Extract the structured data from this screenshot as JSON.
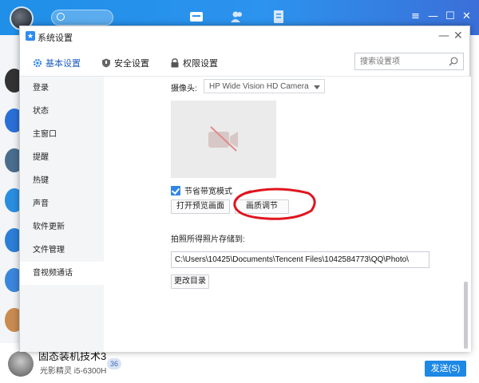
{
  "background_window": {
    "contact_name": "固态装机技术3",
    "contact_sub": "光影精灵 i5-6300H",
    "badge": "36",
    "send_button": "发送(S)",
    "window_controls": [
      "≡",
      "—",
      "☐",
      "✕"
    ]
  },
  "dialog": {
    "title": "系统设置",
    "controls": {
      "minimize": "—",
      "close": "✕"
    },
    "tabs": [
      {
        "label": "基本设置",
        "icon": "gear-icon",
        "active": true
      },
      {
        "label": "安全设置",
        "icon": "shield-icon",
        "active": false
      },
      {
        "label": "权限设置",
        "icon": "lock-icon",
        "active": false
      }
    ],
    "search": {
      "placeholder": "搜索设置项"
    },
    "sidebar": [
      {
        "label": "登录"
      },
      {
        "label": "状态"
      },
      {
        "label": "主窗口"
      },
      {
        "label": "提醒"
      },
      {
        "label": "热键"
      },
      {
        "label": "声音"
      },
      {
        "label": "软件更新"
      },
      {
        "label": "文件管理"
      },
      {
        "label": "音视频通话",
        "active": true
      }
    ],
    "content": {
      "camera_label": "摄像头:",
      "camera_value": "HP Wide Vision HD Camera",
      "bandwidth_checkbox": {
        "label": "节省带宽模式",
        "checked": true
      },
      "open_preview_button": "打开预览画面",
      "quality_button": "画质调节",
      "store_label": "拍照所得照片存储到:",
      "store_path": "C:\\Users\\10425\\Documents\\Tencent Files\\1042584773\\QQ\\Photo\\",
      "change_dir_button": "更改目录"
    }
  },
  "colors": {
    "accent": "#2f86e6",
    "annotation": "#e0141e",
    "header_blue": "#1f8fe8"
  }
}
